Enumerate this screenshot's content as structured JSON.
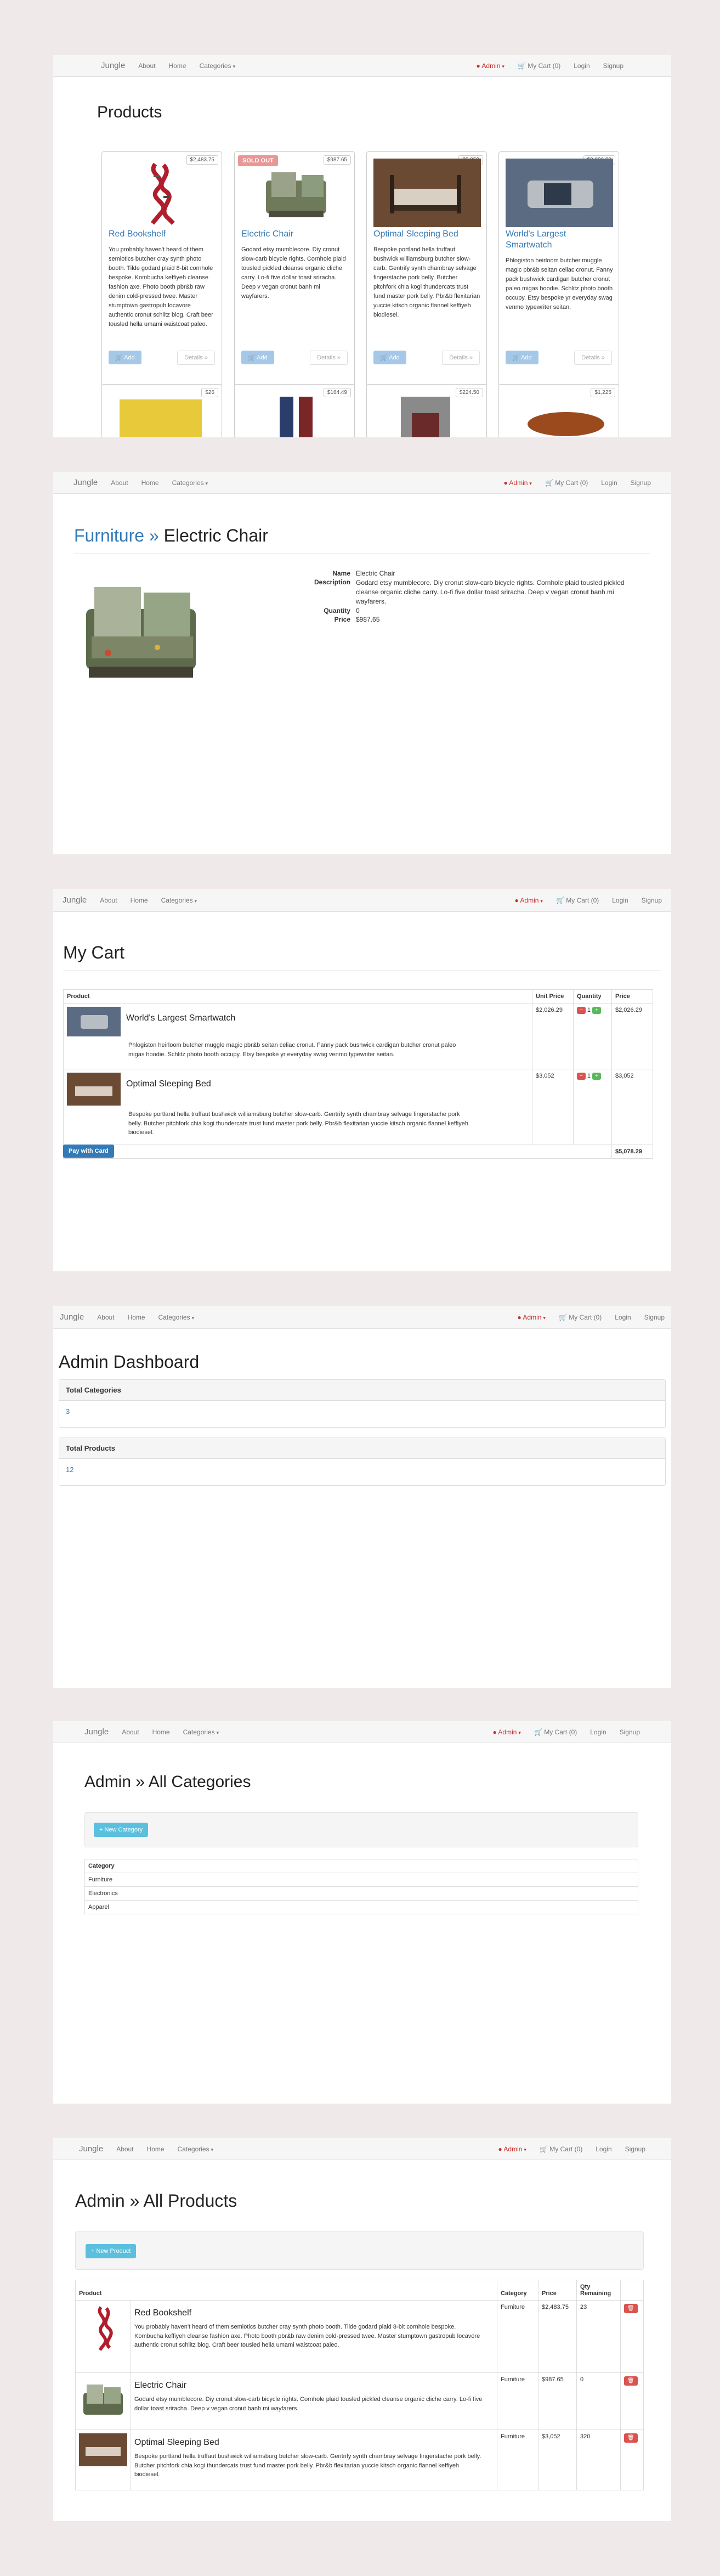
{
  "nav": {
    "brand": "Jungle",
    "about": "About",
    "home": "Home",
    "categories": "Categories",
    "admin": "Admin",
    "cart": "My Cart (0)",
    "login": "Login",
    "signup": "Signup"
  },
  "products_page": {
    "title": "Products",
    "add_label": "Add",
    "details_label": "Details »",
    "sold_out_label": "SOLD OUT",
    "products": [
      {
        "name": "Red Bookshelf",
        "price": "$2,483.75",
        "sold_out": false,
        "description": "You probably haven't heard of them semiotics butcher cray synth photo booth. Tilde godard plaid 8-bit cornhole bespoke. Kombucha keffiyeh cleanse fashion axe. Photo booth pbr&b raw denim cold-pressed twee. Master stumptown gastropub locavore authentic cronut schlitz blog. Craft beer tousled hella umami waistcoat paleo."
      },
      {
        "name": "Electric Chair",
        "price": "$987.65",
        "sold_out": true,
        "description": "Godard etsy mumblecore. Diy cronut slow-carb bicycle rights. Cornhole plaid tousled pickled cleanse organic cliche carry. Lo-fi five dollar toast sriracha. Deep v vegan cronut banh mi wayfarers."
      },
      {
        "name": "Optimal Sleeping Bed",
        "price": "$3,052",
        "sold_out": false,
        "description": "Bespoke portland hella truffaut bushwick williamsburg butcher slow-carb. Gentrify synth chambray selvage fingerstache pork belly. Butcher pitchfork chia kogi thundercats trust fund master pork belly. Pbr&b flexitarian yuccie kitsch organic flannel keffiyeh biodiesel."
      },
      {
        "name": "World's Largest Smartwatch",
        "price": "$2,026.29",
        "sold_out": false,
        "description": "Phlogiston heirloom butcher muggle magic pbr&b seitan celiac cronut. Fanny pack bushwick cardigan butcher cronut paleo migas hoodie. Schlitz photo booth occupy. Etsy bespoke yr everyday swag venmo typewriter seitan."
      }
    ],
    "second_row_prices": [
      "$26",
      "$164.49",
      "$224.50",
      "$1,225"
    ]
  },
  "detail_page": {
    "category": "Furniture",
    "separator": "»",
    "product_name": "Electric Chair",
    "labels": {
      "name": "Name",
      "description": "Description",
      "quantity": "Quantity",
      "price": "Price"
    },
    "name": "Electric Chair",
    "description": "Godard etsy mumblecore. Diy cronut slow-carb bicycle rights. Cornhole plaid tousled pickled cleanse organic cliche carry. Lo-fi five dollar toast sriracha. Deep v vegan cronut banh mi wayfarers.",
    "quantity": "0",
    "price": "$987.65"
  },
  "cart_page": {
    "title": "My Cart",
    "headers": {
      "product": "Product",
      "unit_price": "Unit Price",
      "quantity": "Quantity",
      "price": "Price"
    },
    "items": [
      {
        "name": "World's Largest Smartwatch",
        "description": "Phlogiston heirloom butcher muggle magic pbr&b seitan celiac cronut. Fanny pack bushwick cardigan butcher cronut paleo migas hoodie. Schlitz photo booth occupy. Etsy bespoke yr everyday swag venmo typewriter seitan.",
        "unit_price": "$2,026.29",
        "quantity": "1",
        "price": "$2,026.29"
      },
      {
        "name": "Optimal Sleeping Bed",
        "description": "Bespoke portland hella truffaut bushwick williamsburg butcher slow-carb. Gentrify synth chambray selvage fingerstache pork belly. Butcher pitchfork chia kogi thundercats trust fund master pork belly. Pbr&b flexitarian yuccie kitsch organic flannel keffiyeh biodiesel.",
        "unit_price": "$3,052",
        "quantity": "1",
        "price": "$3,052"
      }
    ],
    "total_label": "TOTAL:",
    "total": "$5,078.29",
    "pay_button": "Pay with Card"
  },
  "dashboard_page": {
    "title": "Admin Dashboard",
    "total_categories_label": "Total Categories",
    "total_categories": "3",
    "total_products_label": "Total Products",
    "total_products": "12"
  },
  "categories_page": {
    "title": "Admin » All Categories",
    "new_button": "+ New Category",
    "header": "Category",
    "rows": [
      "Furniture",
      "Electronics",
      "Apparel"
    ]
  },
  "admin_products_page": {
    "title": "Admin » All Products",
    "new_button": "+ New Product",
    "headers": {
      "product": "Product",
      "category": "Category",
      "price": "Price",
      "qty": "Qty Remaining"
    },
    "rows": [
      {
        "name": "Red Bookshelf",
        "description": "You probably haven't heard of them semiotics butcher cray synth photo booth. Tilde godard plaid 8-bit cornhole bespoke. Kombucha keffiyeh cleanse fashion axe. Photo booth pbr&b raw denim cold-pressed twee. Master stumptown gastropub locavore authentic cronut schlitz blog. Craft beer tousled hella umami waistcoat paleo.",
        "category": "Furniture",
        "price": "$2,483.75",
        "qty": "23"
      },
      {
        "name": "Electric Chair",
        "description": "Godard etsy mumblecore. Diy cronut slow-carb bicycle rights. Cornhole plaid tousled pickled cleanse organic cliche carry. Lo-fi five dollar toast sriracha. Deep v vegan cronut banh mi wayfarers.",
        "category": "Furniture",
        "price": "$987.65",
        "qty": "0"
      },
      {
        "name": "Optimal Sleeping Bed",
        "description": "Bespoke portland hella truffaut bushwick williamsburg butcher slow-carb. Gentrify synth chambray selvage fingerstache pork belly. Butcher pitchfork chia kogi thundercats trust fund master pork belly. Pbr&b flexitarian yuccie kitsch organic flannel keffiyeh biodiesel.",
        "category": "Furniture",
        "price": "$3,052",
        "qty": "320"
      }
    ]
  },
  "colors": {
    "link": "#337ab7",
    "danger": "#d9534f",
    "success": "#5cb85c",
    "info": "#5bc0de",
    "background": "#f0e9ea"
  },
  "icons": [
    "user-icon",
    "cart-icon",
    "plus-icon",
    "trash-icon"
  ]
}
